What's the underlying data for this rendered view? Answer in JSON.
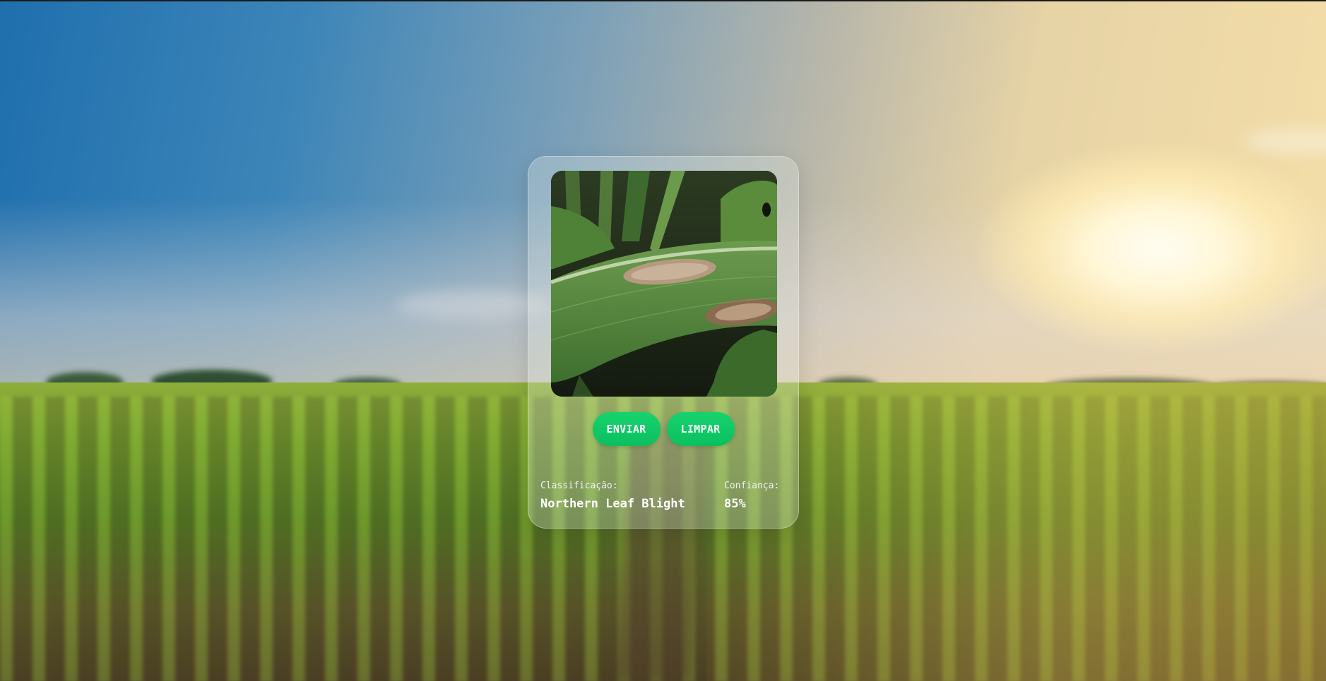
{
  "actions": {
    "send_label": "ENVIAR",
    "clear_label": "LIMPAR"
  },
  "result": {
    "classification_label": "Classificação:",
    "classification_value": "Northern Leaf Blight",
    "confidence_label": "Confiança:",
    "confidence_value": "85%"
  },
  "colors": {
    "button": "#0bbf5f",
    "text": "#ffffff"
  }
}
